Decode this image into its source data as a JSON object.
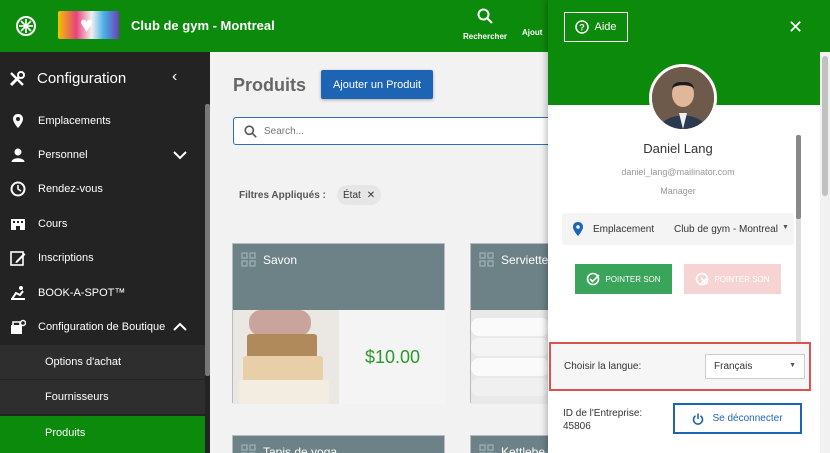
{
  "header": {
    "club_name": "Club de gym - Montreal",
    "search_label": "Rechercher",
    "add_label": "Ajout"
  },
  "sidebar": {
    "title": "Configuration",
    "items": [
      {
        "label": "Emplacements",
        "icon": "map-pin-icon"
      },
      {
        "label": "Personnel",
        "icon": "person-icon",
        "expandable": true
      },
      {
        "label": "Rendez-vous",
        "icon": "clock-icon"
      },
      {
        "label": "Cours",
        "icon": "building-icon"
      },
      {
        "label": "Inscriptions",
        "icon": "edit-icon"
      },
      {
        "label": "BOOK-A-SPOT™",
        "icon": "spot-icon"
      },
      {
        "label": "Configuration de Boutique",
        "icon": "shop-config-icon",
        "expanded": true
      },
      {
        "label": "Options d'achat"
      },
      {
        "label": "Fournisseurs"
      },
      {
        "label": "Produits",
        "active": true
      }
    ]
  },
  "main": {
    "title": "Produits",
    "add_button": "Ajouter un Produit",
    "search_placeholder": "Search...",
    "filters_label": "Filtres Appliqués :",
    "filter_chip": "État",
    "products": [
      {
        "name": "Savon",
        "price": "$10.00"
      },
      {
        "name": "Serviette"
      },
      {
        "name": "Tapis de yoga"
      },
      {
        "name": "Kettlebe"
      }
    ]
  },
  "drawer": {
    "help_label": "Aide",
    "user_name": "Daniel Lang",
    "user_email": "daniel_lang@mailinator.com",
    "user_role": "Manager",
    "location_label": "Emplacement",
    "location_value": "Club de gym - Montreal",
    "punch_in": "POINTER SON",
    "punch_out": "POINTER SON",
    "language_label": "Choisir la langue:",
    "language_value": "Français",
    "company_label": "ID de l'Entreprise:",
    "company_id": "45806",
    "logout_label": "Se déconnecter"
  },
  "colors": {
    "brand_green": "#0c8a0c",
    "primary_blue": "#1e64b4",
    "highlight_red": "#d9534f",
    "card_header": "#6c8287"
  }
}
